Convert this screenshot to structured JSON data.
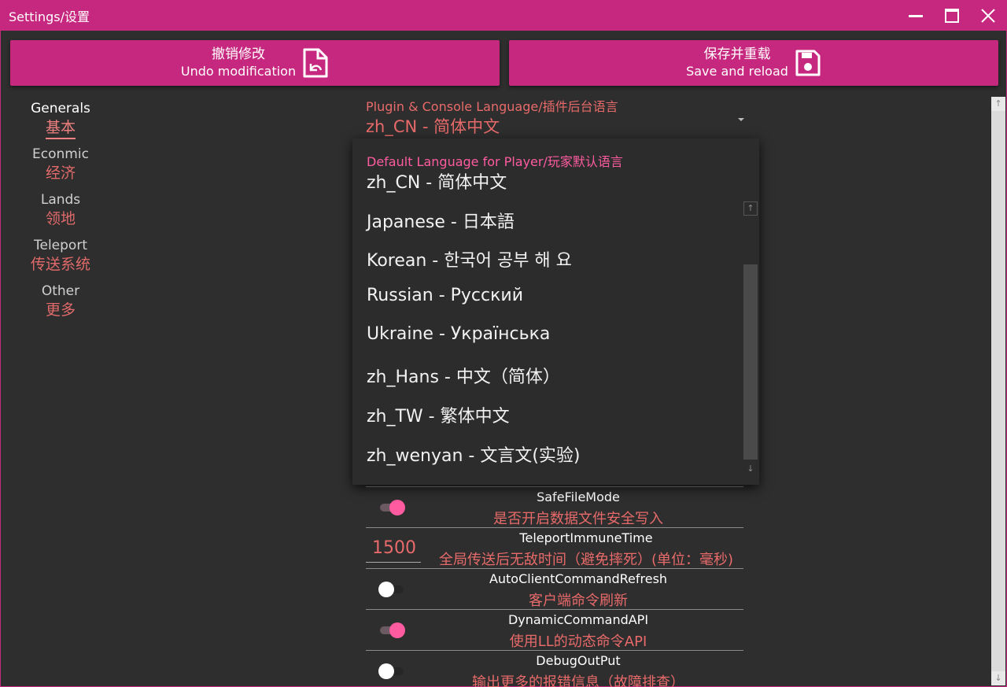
{
  "window": {
    "title": "Settings/设置"
  },
  "toolbar": {
    "undo": {
      "zh": "撤销修改",
      "en": "Undo modification"
    },
    "save": {
      "zh": "保存并重载",
      "en": "Save and reload"
    }
  },
  "sidebar": {
    "items": [
      {
        "en": "Generals",
        "zh": "基本"
      },
      {
        "en": "Econmic",
        "zh": "经济"
      },
      {
        "en": "Lands",
        "zh": "领地"
      },
      {
        "en": "Teleport",
        "zh": "传送系统"
      },
      {
        "en": "Other",
        "zh": "更多"
      }
    ],
    "active_index": 0
  },
  "plugin_language": {
    "label": "Plugin & Console Language/插件后台语言",
    "value": "zh_CN - 简体中文"
  },
  "dropdown": {
    "label": "Default Language for Player/玩家默认语言",
    "options": [
      "zh_CN - 简体中文",
      "Japanese - 日本語",
      "Korean - 한국어 공부 해 요",
      "Russian - Русский",
      "Ukraine - Українська",
      "zh_Hans - 中文（简体）",
      "zh_TW - 繁体中文",
      "zh_wenyan - 文言文(实验)"
    ]
  },
  "settings": [
    {
      "name": "SafeFileMode",
      "desc": "是否开启数据文件安全写入",
      "type": "toggle",
      "value": true
    },
    {
      "name": "TeleportImmuneTime",
      "desc": "全局传送后无敌时间（避免摔死）(单位：毫秒)",
      "type": "number",
      "value": "1500"
    },
    {
      "name": "AutoClientCommandRefresh",
      "desc": "客户端命令刷新",
      "type": "toggle",
      "value": false
    },
    {
      "name": "DynamicCommandAPI",
      "desc": "使用LL的动态命令API",
      "type": "toggle",
      "value": true
    },
    {
      "name": "DebugOutPut",
      "desc": "输出更多的报错信息（故障排查）",
      "type": "toggle",
      "value": false
    }
  ],
  "colors": {
    "accent": "#c7287f",
    "label_red": "#e86a6a",
    "toggle_pink": "#ff5ba0",
    "background": "#2e2e2e"
  }
}
